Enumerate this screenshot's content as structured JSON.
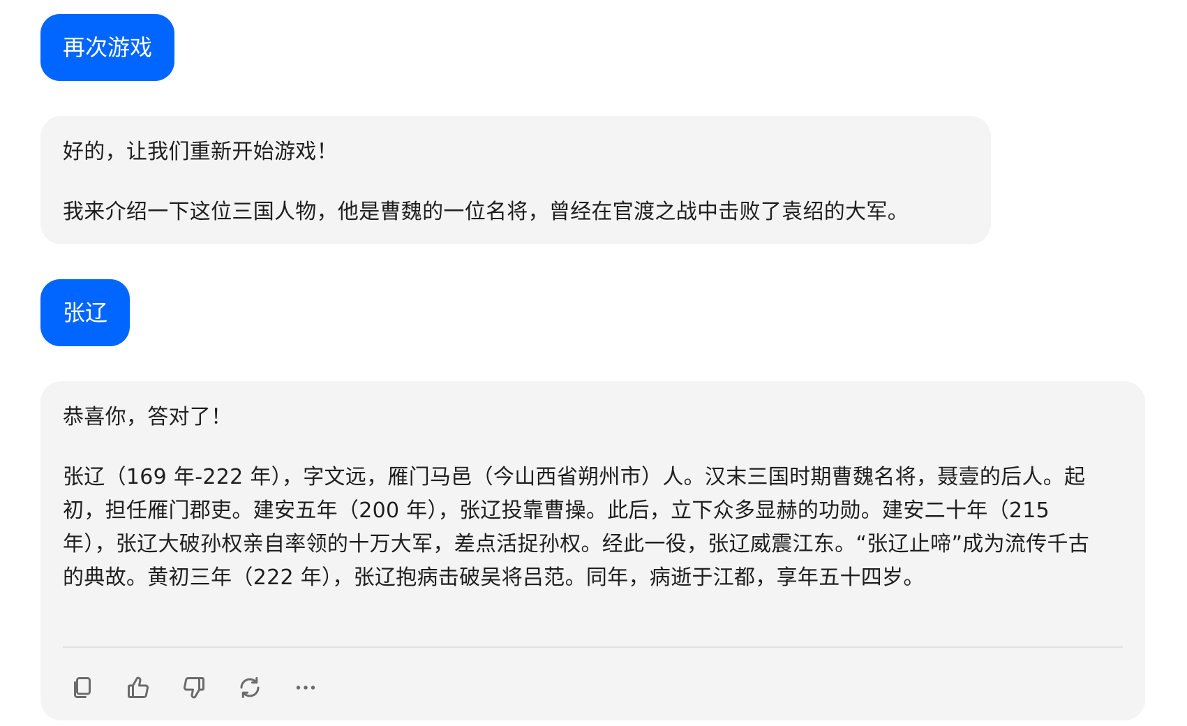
{
  "messages": {
    "user_1": "再次游戏",
    "bot_1": {
      "line_1": "好的，让我们重新开始游戏！",
      "line_2": "我来介绍一下这位三国人物，他是曹魏的一位名将，曾经在官渡之战中击败了袁绍的大军。"
    },
    "user_2": "张辽",
    "bot_2": {
      "line_1": "恭喜你，答对了！",
      "line_2": "张辽（169 年-222 年），字文远，雁门马邑（今山西省朔州市）人。汉末三国时期曹魏名将，聂壹的后人。起初，担任雁门郡吏。建安五年（200 年），张辽投靠曹操。此后，立下众多显赫的功勋。建安二十年（215 年），张辽大破孙权亲自率领的十万大军，差点活捉孙权。经此一役，张辽威震江东。“张辽止啼”成为流传千古的典故。黄初三年（222 年），张辽抱病击破吴将吕范。同年，病逝于江都，享年五十四岁。"
    }
  },
  "actions": [
    {
      "name": "copy",
      "icon": "copy-icon"
    },
    {
      "name": "like",
      "icon": "thumbs-up-icon"
    },
    {
      "name": "dislike",
      "icon": "thumbs-down-icon"
    },
    {
      "name": "regenerate",
      "icon": "refresh-icon"
    },
    {
      "name": "more",
      "icon": "more-horizontal-icon"
    }
  ],
  "colors": {
    "user_bubble": "#0066ff",
    "bot_bubble": "#f4f4f4",
    "icon": "#6b6b6b"
  }
}
